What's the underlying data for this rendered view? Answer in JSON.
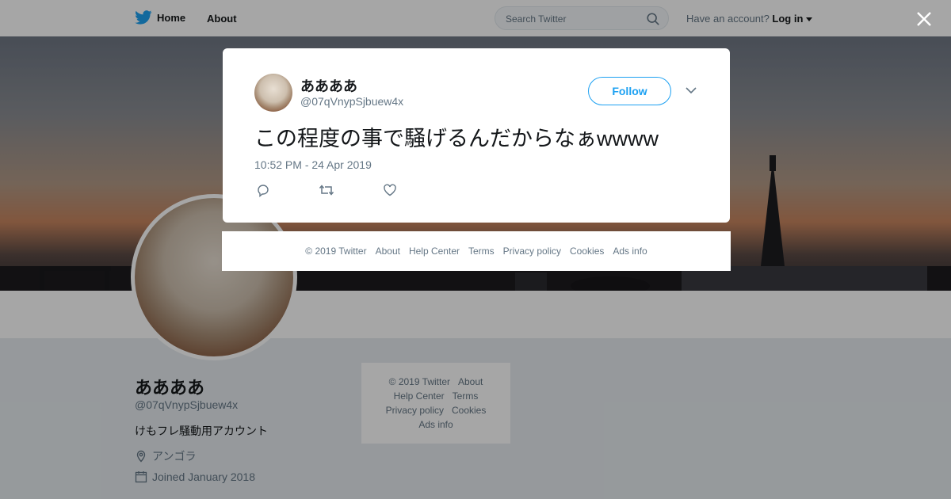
{
  "topnav": {
    "home_label": "Home",
    "about_label": "About",
    "search_placeholder": "Search Twitter",
    "account_prompt": "Have an account?",
    "login_label": "Log in"
  },
  "profile": {
    "name": "ああああ",
    "handle": "@07qVnypSjbuew4x",
    "bio": "けもフレ騒動用アカウント",
    "location": "アンゴラ",
    "joined": "Joined January 2018"
  },
  "tweet": {
    "author_name": "ああああ",
    "author_handle": "@07qVnypSjbuew4x",
    "follow_label": "Follow",
    "text": "この程度の事で騒げるんだからなぁwwww",
    "timestamp": "10:52 PM - 24 Apr 2019"
  },
  "modal_footer": [
    "© 2019 Twitter",
    "About",
    "Help Center",
    "Terms",
    "Privacy policy",
    "Cookies",
    "Ads info"
  ],
  "side_footer": {
    "row1": [
      "© 2019 Twitter",
      "About"
    ],
    "row2": [
      "Help Center",
      "Terms"
    ],
    "row3": [
      "Privacy policy",
      "Cookies"
    ],
    "row4": [
      "Ads info"
    ]
  },
  "colors": {
    "accent": "#1da1f2",
    "text": "#14171a",
    "muted": "#657786"
  },
  "icons": [
    "twitter-bird-icon",
    "search-icon",
    "caret-down-icon",
    "close-icon",
    "chevron-down-icon",
    "reply-icon",
    "retweet-icon",
    "like-icon",
    "location-icon",
    "calendar-icon"
  ]
}
